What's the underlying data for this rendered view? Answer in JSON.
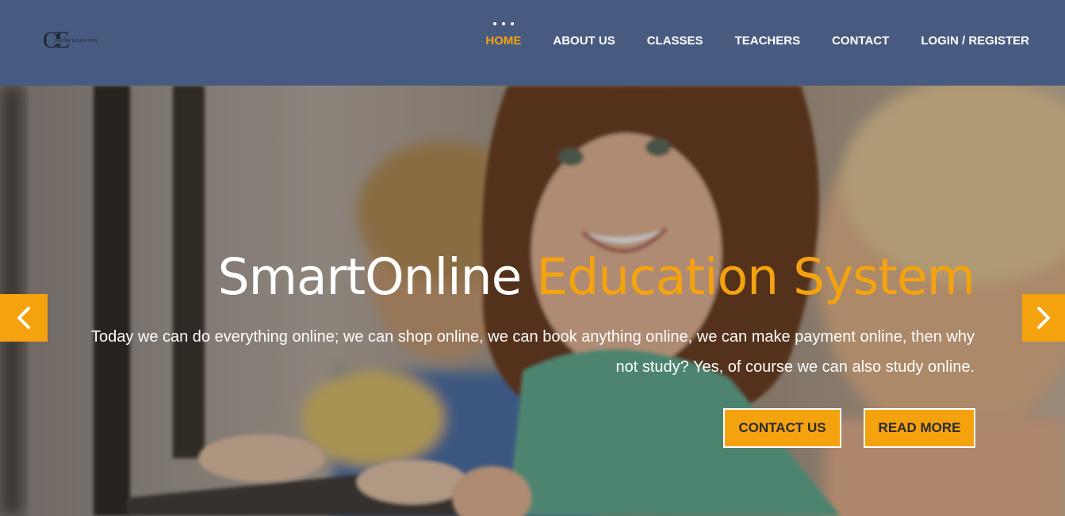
{
  "logo": {
    "mark": "OE",
    "tag": "ONLINE EDUCATION"
  },
  "nav": {
    "items": [
      {
        "label": "HOME",
        "active": true
      },
      {
        "label": "ABOUT US",
        "active": false
      },
      {
        "label": "CLASSES",
        "active": false
      },
      {
        "label": "TEACHERS",
        "active": false
      },
      {
        "label": "CONTACT",
        "active": false
      },
      {
        "label": "LOGIN / REGISTER",
        "active": false
      }
    ]
  },
  "hero": {
    "title_plain": "SmartOnline ",
    "title_accent": "Education System",
    "description": "Today we can do everything online; we can shop online, we can book anything online, we can make payment online, then why not study? Yes, of course we can also study online.",
    "contact_button": "CONTACT US",
    "read_more_button": "READ MORE",
    "prev_icon": "chevron-left-icon",
    "next_icon": "chevron-right-icon"
  },
  "colors": {
    "header_bg": "#475b80",
    "accent": "#f5a20f",
    "text_light": "#ffffff"
  }
}
